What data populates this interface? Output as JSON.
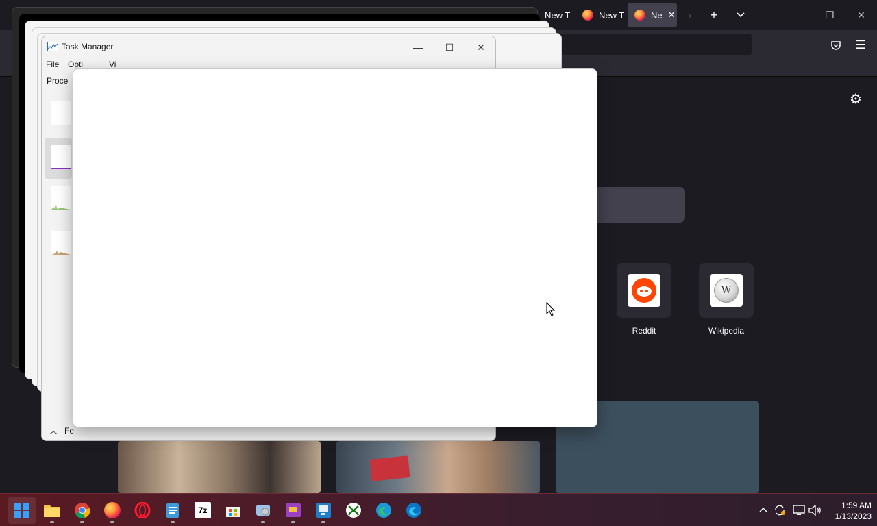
{
  "browser": {
    "tabs": [
      {
        "label": "New T",
        "active": false
      },
      {
        "label": "New T",
        "active": false
      },
      {
        "label": "Ne",
        "active": true
      }
    ],
    "new_tab_icon": "plus-icon",
    "tab_list_icon": "chevron-down-icon",
    "window_controls": {
      "minimize": "—",
      "restore": "❐",
      "close": "✕"
    },
    "toolbar_icons": [
      "pocket-icon",
      "menu-icon"
    ],
    "settings_icon": "gear-icon",
    "shortcuts": [
      {
        "label": "Reddit",
        "icon": "reddit-icon",
        "color": "#ff4500"
      },
      {
        "label": "Wikipedia",
        "icon": "wikipedia-icon",
        "color": "#ffffff"
      }
    ]
  },
  "task_manager": {
    "title": "Task Manager",
    "controls": {
      "minimize": "—",
      "maximize": "☐",
      "close": "✕"
    },
    "menu": [
      {
        "label": "File"
      },
      {
        "label": "Opti"
      },
      {
        "label": "Vi"
      }
    ],
    "tab_visible": "Proce",
    "perf_graphs": [
      {
        "name": "cpu",
        "color": "#1778c8"
      },
      {
        "name": "memory",
        "color": "#8b2fc9"
      },
      {
        "name": "disk",
        "color": "#4ea020"
      },
      {
        "name": "ethernet",
        "color": "#a75f15"
      }
    ],
    "footer": "Fe"
  },
  "taskbar": {
    "apps": [
      {
        "name": "start",
        "icon": "windows-icon"
      },
      {
        "name": "file-explorer",
        "icon": "folder-icon"
      },
      {
        "name": "chrome",
        "icon": "chrome-icon"
      },
      {
        "name": "firefox",
        "icon": "firefox-icon"
      },
      {
        "name": "opera",
        "icon": "opera-icon"
      },
      {
        "name": "notepad",
        "icon": "notepad-icon"
      },
      {
        "name": "7-zip",
        "icon": "7zip-icon",
        "text": "7z"
      },
      {
        "name": "microsoft-store",
        "icon": "store-icon"
      },
      {
        "name": "photos",
        "icon": "photos-icon"
      },
      {
        "name": "media-app",
        "icon": "media-icon"
      },
      {
        "name": "remote-desktop",
        "icon": "remote-desktop-icon"
      },
      {
        "name": "xbox",
        "icon": "xbox-icon"
      },
      {
        "name": "edge",
        "icon": "edge-icon"
      },
      {
        "name": "edge-beta",
        "icon": "edge-beta-icon"
      }
    ],
    "tray": [
      "chevron-up-icon",
      "sync-icon",
      "network-icon",
      "volume-icon"
    ],
    "clock": {
      "time": "1:59 AM",
      "date": "1/13/2023"
    }
  }
}
